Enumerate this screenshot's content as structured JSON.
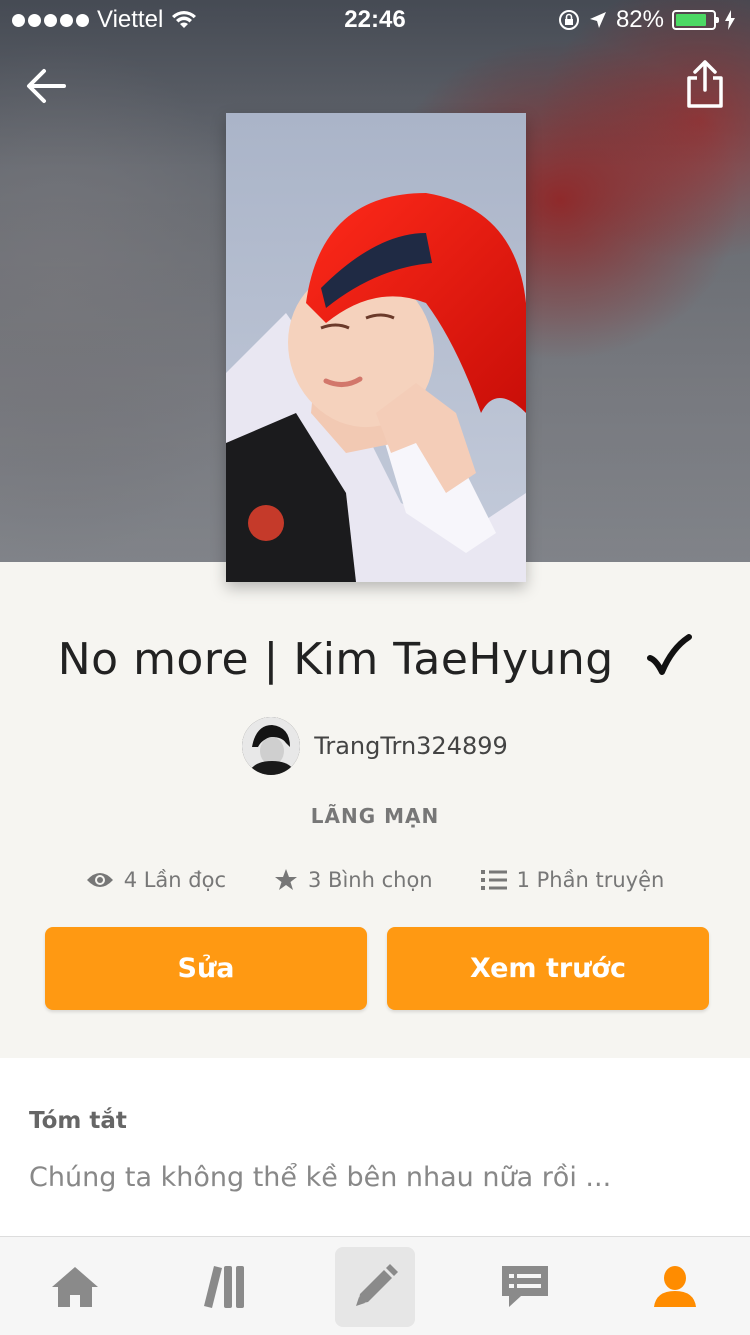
{
  "status_bar": {
    "carrier": "Viettel",
    "time": "22:46",
    "battery_percent": "82%",
    "battery_level": 0.82
  },
  "story": {
    "title": "No more | Kim TaeHyung",
    "author": "TrangTrn324899",
    "genre": "LÃNG MẠN",
    "stats": {
      "reads": "4 Lần đọc",
      "votes": "3 Bình chọn",
      "parts": "1 Phần truyện"
    }
  },
  "actions": {
    "edit_label": "Sửa",
    "preview_label": "Xem trước"
  },
  "summary": {
    "heading": "Tóm tắt",
    "text": "Chúng ta không thể kề bên nhau nữa rồi ..."
  },
  "colors": {
    "accent": "#ff9912",
    "active_nav": "#ff8c00",
    "battery": "#4cd964"
  },
  "nav": {
    "items": [
      "home-icon",
      "library-icon",
      "write-icon",
      "messages-icon",
      "profile-icon"
    ],
    "active": "profile-icon"
  }
}
